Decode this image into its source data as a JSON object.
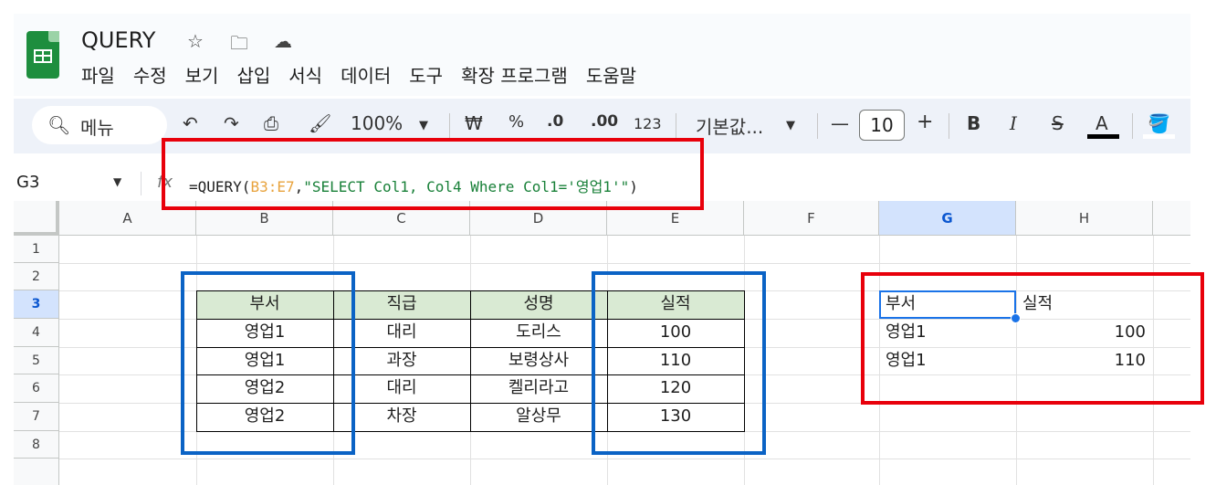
{
  "app": {
    "title": "QUERY",
    "icons": [
      "star-icon",
      "move-to-folder-icon",
      "cloud-saved-icon"
    ],
    "menu": [
      "파일",
      "수정",
      "보기",
      "삽입",
      "서식",
      "데이터",
      "도구",
      "확장 프로그램",
      "도움말"
    ]
  },
  "toolbar": {
    "search_label": "메뉴",
    "zoom": "100%",
    "currency": "₩",
    "percent": "%",
    "decrease_decimal": ".0",
    "increase_decimal": ".00",
    "number_format": "123",
    "font": "기본값...",
    "font_size": "10",
    "minus": "—",
    "plus": "+",
    "bold": "B",
    "italic": "I",
    "strike": "S",
    "text_color": "A"
  },
  "formula_bar": {
    "name_box": "G3",
    "fx": "fx",
    "formula_prefix": "=QUERY(",
    "formula_range": "B3:E7",
    "formula_comma": ",",
    "formula_string": "\"SELECT Col1, Col4 Where Col1='영업1'\"",
    "formula_suffix": ")"
  },
  "columns": [
    "A",
    "B",
    "C",
    "D",
    "E",
    "F",
    "G",
    "H"
  ],
  "rows": [
    "1",
    "2",
    "3",
    "4",
    "5",
    "6",
    "7",
    "8"
  ],
  "selected_column": "G",
  "selected_row": "3",
  "source_table": {
    "headers": [
      "부서",
      "직급",
      "성명",
      "실적"
    ],
    "rows": [
      [
        "영업1",
        "대리",
        "도리스",
        "100"
      ],
      [
        "영업1",
        "과장",
        "보령상사",
        "110"
      ],
      [
        "영업2",
        "대리",
        "켈리라고",
        "120"
      ],
      [
        "영업2",
        "차장",
        "알상무",
        "130"
      ]
    ]
  },
  "query_result": {
    "headers": [
      "부서",
      "실적"
    ],
    "rows": [
      [
        "영업1",
        "100"
      ],
      [
        "영업1",
        "110"
      ]
    ]
  },
  "colors": {
    "header_fill": "#d9ead3",
    "highlight_red": "#e8000b",
    "highlight_blue": "#0b63c5",
    "selection": "#1a73e8"
  }
}
